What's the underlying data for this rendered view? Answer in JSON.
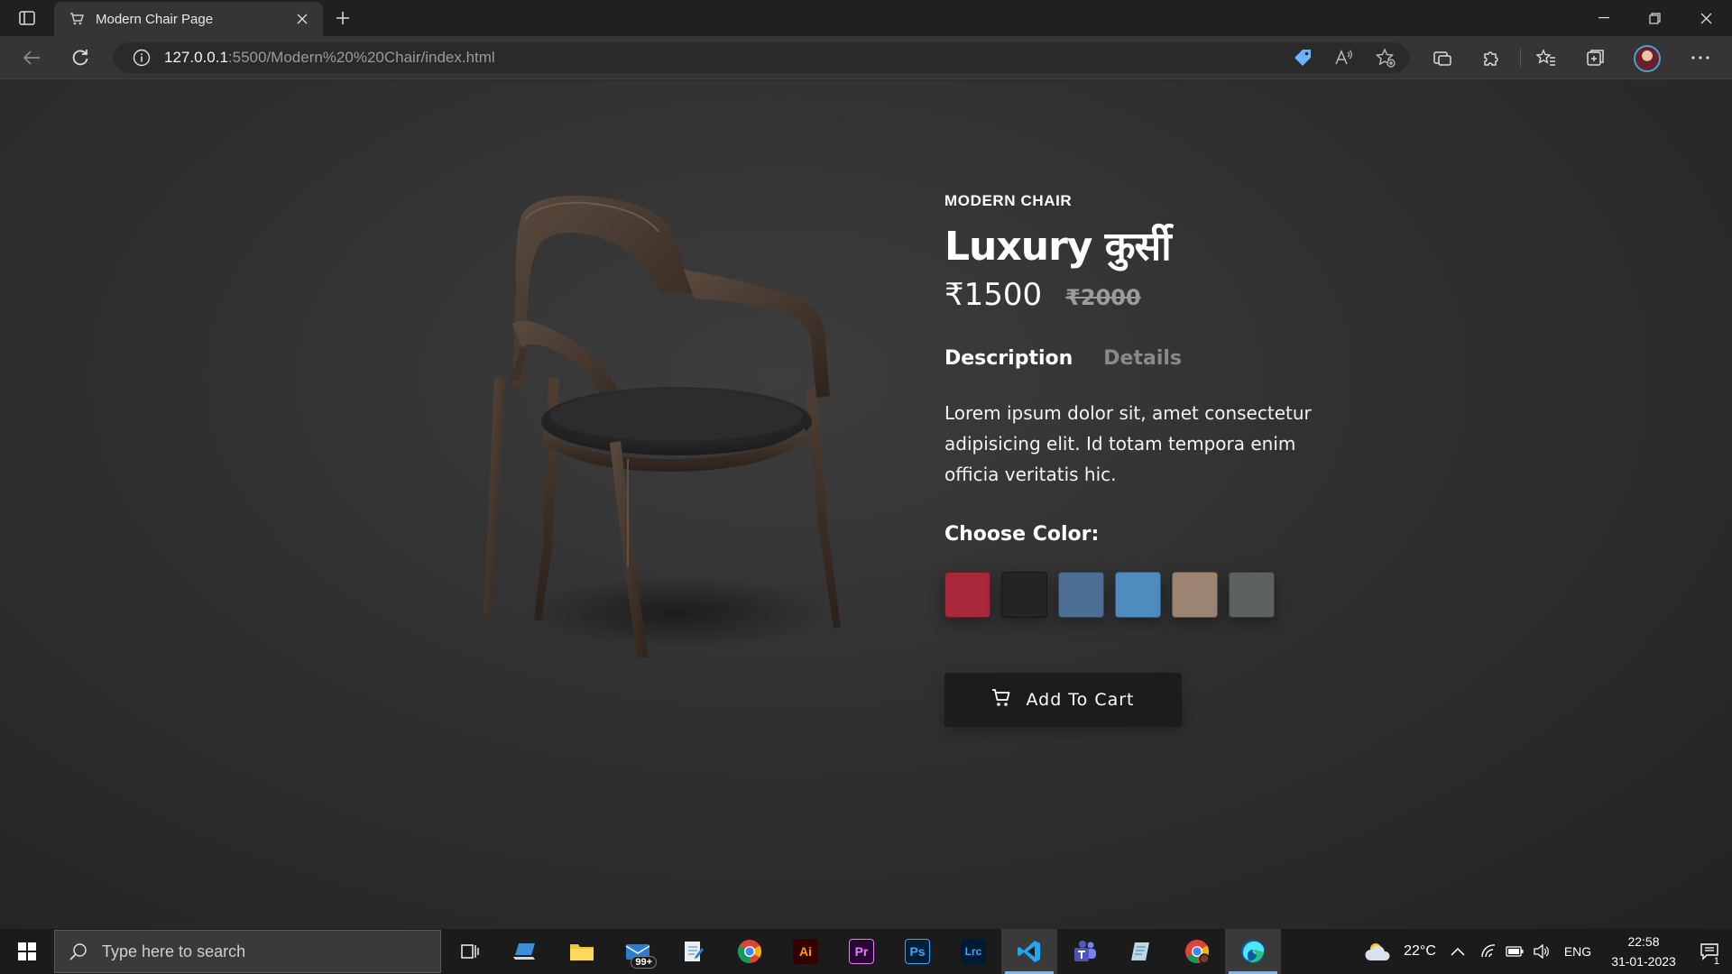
{
  "browser": {
    "tab_title": "Modern Chair Page",
    "url_host": "127.0.0.1",
    "url_rest": ":5500/Modern%20%20Chair/index.html"
  },
  "product": {
    "eyebrow": "MODERN CHAIR",
    "title": "Luxury कुर्सी",
    "price_current": "₹1500",
    "price_original": "₹2000",
    "tabs": [
      {
        "label": "Description",
        "active": true
      },
      {
        "label": "Details",
        "active": false
      }
    ],
    "description": "Lorem ipsum dolor sit, amet consectetur adipisicing elit. Id totam tempora enim officia veritatis hic.",
    "choose_color_label": "Choose Color:",
    "colors": [
      {
        "name": "red-fabric",
        "hex": "#a8283a"
      },
      {
        "name": "black-fabric",
        "hex": "#242424"
      },
      {
        "name": "denim-fabric",
        "hex": "#4d6f96"
      },
      {
        "name": "light-blue-fabric",
        "hex": "#4e8cc0"
      },
      {
        "name": "beige-fabric",
        "hex": "#9c8473"
      },
      {
        "name": "grey-fabric",
        "hex": "#5d6260"
      }
    ],
    "add_to_cart_label": "Add To Cart"
  },
  "taskbar": {
    "search_placeholder": "Type here to search",
    "mail_badge": "99+",
    "weather": "22°C",
    "language": "ENG",
    "time": "22:58",
    "date": "31-01-2023",
    "notification_count": "1"
  },
  "colors": {
    "page_bg": "#2b2b2b",
    "cart_button_bg": "#1c1c1c",
    "tab_inactive": "#8a8a8a"
  }
}
